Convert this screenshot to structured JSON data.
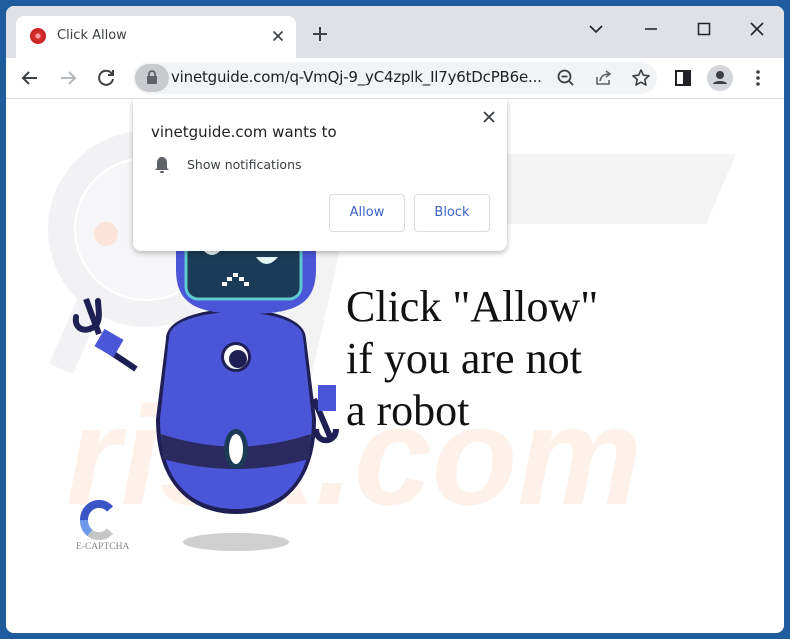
{
  "browser": {
    "tab": {
      "title": "Click Allow",
      "favicon": "red-circle-icon",
      "close_icon": "close-icon"
    },
    "new_tab_icon": "plus-icon",
    "window_controls": [
      "chevron-down-icon",
      "minimize-icon",
      "maximize-icon",
      "close-icon"
    ],
    "toolbar": {
      "back_icon": "arrow-left-icon",
      "forward_icon": "arrow-right-icon",
      "reload_icon": "reload-icon",
      "lock_icon": "lock-icon",
      "url": "vinetguide.com/q-VmQj-9_yC4zplk_Il7y6tDcPB6e...",
      "zoom_icon": "zoom-out-icon",
      "share_icon": "share-icon",
      "bookmark_icon": "star-icon",
      "sidepanel_icon": "side-panel-icon",
      "profile_icon": "profile-icon",
      "menu_icon": "kebab-menu-icon"
    }
  },
  "permission_popup": {
    "title": "vinetguide.com wants to",
    "permission": {
      "icon": "bell-icon",
      "label": "Show notifications"
    },
    "allow_label": "Allow",
    "block_label": "Block"
  },
  "page": {
    "headline_lines": [
      "Click \"Allow\"",
      "if you are not",
      "a robot"
    ],
    "logo_label": "E-CAPTCHA",
    "colors": {
      "robot_body": "#4a55d8",
      "robot_dark": "#1e1f55",
      "screen": "#1b3b56",
      "screen_rim": "#5fc8d0",
      "frame": "#1f5c9e"
    }
  }
}
